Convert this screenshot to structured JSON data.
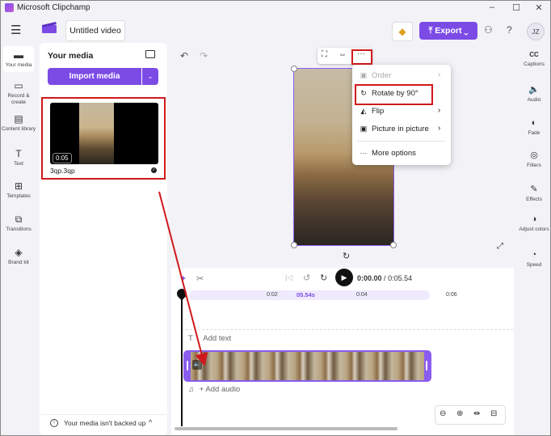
{
  "window": {
    "title": "Microsoft Clipchamp",
    "minimize": "–",
    "maximize": "☐",
    "close": "✕"
  },
  "header": {
    "menu_icon": "☰",
    "project_title": "Untitled video",
    "premium_icon": "◆",
    "export_label": "Export",
    "export_icon": "⤒",
    "export_chevron": "⌄",
    "share_icon": "⚇",
    "help_icon": "?",
    "avatar_initials": "JZ"
  },
  "left_nav": [
    {
      "label": "Your media",
      "icon": "▬"
    },
    {
      "label": "Record & create",
      "icon": "▭"
    },
    {
      "label": "Content library",
      "icon": "▤"
    },
    {
      "label": "Text",
      "icon": "T"
    },
    {
      "label": "Templates",
      "icon": "⊞"
    },
    {
      "label": "Transitions",
      "icon": "⧉"
    },
    {
      "label": "Brand kit",
      "icon": "◈"
    }
  ],
  "media_panel": {
    "title": "Your media",
    "import_label": "Import media",
    "import_dropdown": "⌄",
    "item": {
      "duration": "0:05",
      "filename": "3qp.3qp",
      "check": "✓"
    },
    "backup_text": "Your media isn't backed up",
    "backup_icon": "!",
    "backup_chevron": "^"
  },
  "preview": {
    "undo_icon": "↶",
    "redo_icon": "↷",
    "toolbar": {
      "crop_icon": "⛶",
      "fit_icon": "⇔",
      "more_icon": "···"
    },
    "rotate_handle_icon": "↻",
    "fullscreen_icon": "⤢"
  },
  "context_menu": {
    "items": [
      {
        "label": "Order",
        "icon": "▣",
        "arrow": "›",
        "disabled": true
      },
      {
        "label": "Rotate by 90°",
        "icon": "↻",
        "arrow": ""
      },
      {
        "label": "Flip",
        "icon": "◭",
        "arrow": "›"
      },
      {
        "label": "Picture in picture",
        "icon": "▣",
        "arrow": "›"
      },
      {
        "label": "More options",
        "icon": "···",
        "arrow": ""
      }
    ]
  },
  "right_nav": [
    {
      "label": "Captions",
      "icon": "CC"
    },
    {
      "label": "Audio",
      "icon": "🔈"
    },
    {
      "label": "Fade",
      "icon": "◐"
    },
    {
      "label": "Filters",
      "icon": "◎"
    },
    {
      "label": "Effects",
      "icon": "✎"
    },
    {
      "label": "Adjust colors",
      "icon": "◑"
    },
    {
      "label": "Speed",
      "icon": "◔"
    }
  ],
  "timeline": {
    "split_icon": "✂",
    "magic_icon": "✦",
    "skip_back_icon": "|◁",
    "back5_icon": "↺",
    "fwd5_icon": "↻",
    "play_icon": "▶",
    "skip_fwd_icon": "▷|",
    "current_time": "0:00.00",
    "separator": "/",
    "total_time": "0:05.54",
    "ruler": [
      "0:02",
      "05.54s",
      "0:04",
      "0:06"
    ],
    "add_text": "Add text",
    "text_icon": "T",
    "add_audio": "+ Add audio",
    "audio_icon": "♫",
    "clip_volume_icon": "🔈",
    "zoom": {
      "zoom_out": "⊖",
      "zoom_in": "⊕",
      "fit": "⇹",
      "expand": "⊟"
    }
  },
  "colors": {
    "accent": "#7c4be6",
    "highlight_box": "#d0191c",
    "selection": "#8a5cf0"
  }
}
